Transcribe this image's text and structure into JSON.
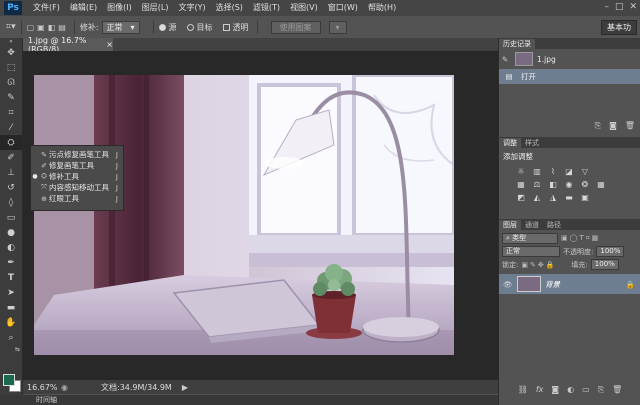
{
  "app": {
    "logo": "Ps"
  },
  "menu": [
    "文件(F)",
    "编辑(E)",
    "图像(I)",
    "图层(L)",
    "文字(Y)",
    "选择(S)",
    "滤镜(T)",
    "视图(V)",
    "窗口(W)",
    "帮助(H)"
  ],
  "options": {
    "repair_label": "修补:",
    "repair_value": "正常",
    "source_label": "源",
    "target_label": "目标",
    "transparent_label": "透明",
    "pattern_button": "使用图案",
    "workspace": "基本功"
  },
  "document": {
    "tab_title": "1.jpg @ 16.7%(RGB/8)",
    "tab_close": "×",
    "zoom": "16.67%",
    "doc_info": "文档:34.9M/34.9M"
  },
  "timeline_label": "时间轴",
  "flyout": {
    "items": [
      {
        "label": "污点修复画笔工具",
        "key": "J",
        "icon": "spot-healing-brush-icon",
        "selected": false
      },
      {
        "label": "修复画笔工具",
        "key": "J",
        "icon": "healing-brush-icon",
        "selected": false
      },
      {
        "label": "修补工具",
        "key": "J",
        "icon": "patch-icon",
        "selected": true
      },
      {
        "label": "内容感知移动工具",
        "key": "J",
        "icon": "content-aware-move-icon",
        "selected": false
      },
      {
        "label": "红眼工具",
        "key": "J",
        "icon": "red-eye-icon",
        "selected": false
      }
    ]
  },
  "history": {
    "tab": "历史记录",
    "snapshot": "1.jpg",
    "states": [
      "打开"
    ]
  },
  "adjustments": {
    "tabs": [
      "调整",
      "样式"
    ],
    "title": "添加调整"
  },
  "layers": {
    "tabs": [
      "图层",
      "通道",
      "路径"
    ],
    "kind": "类型",
    "blend": "正常",
    "opacity_label": "不透明度:",
    "opacity": "100%",
    "lock_label": "锁定:",
    "fill_label": "填充:",
    "fill": "100%",
    "layer_name": "背景"
  },
  "colors": {
    "foreground": "#1a6b4e",
    "background": "#ffffff",
    "accent": "#6f7d91"
  }
}
